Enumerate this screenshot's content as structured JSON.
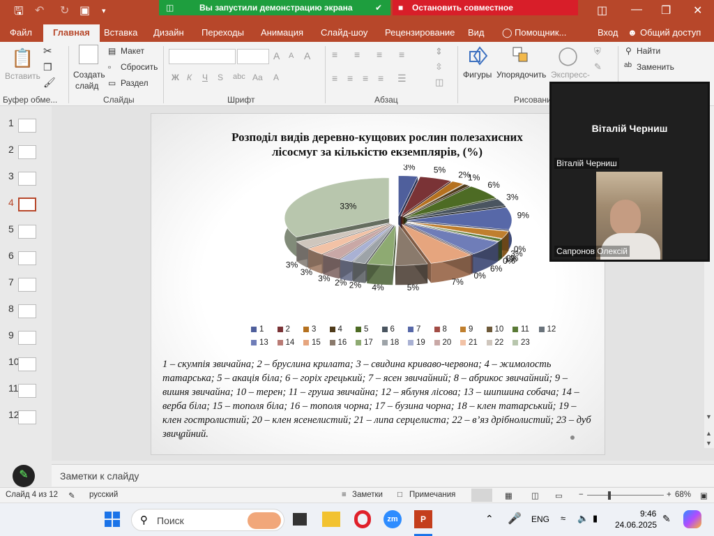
{
  "share": {
    "running": "Вы запустили демонстрацию экрана",
    "stop": "Остановить совместное использование"
  },
  "menu": {
    "file": "Файл",
    "home": "Главная",
    "insert": "Вставка",
    "design": "Дизайн",
    "transitions": "Переходы",
    "animation": "Анимация",
    "slideshow": "Слайд-шоу",
    "review": "Рецензирование",
    "view": "Вид",
    "helper": "Помощник...",
    "signin": "Вход",
    "share_access": "Общий доступ"
  },
  "ribbon": {
    "paste": "Вставить",
    "clipboard": "Буфер обме...",
    "new_slide_1": "Создать",
    "new_slide_2": "слайд",
    "layout": "Макет",
    "reset": "Сбросить",
    "section": "Раздел",
    "slides": "Слайды",
    "font": "Шрифт",
    "paragraph": "Абзац",
    "shapes": "Фигуры",
    "arrange": "Упорядочить",
    "express": "Экспресс-",
    "drawing": "Рисовани",
    "find": "Найти",
    "replace": "Заменить",
    "bold": "Ж",
    "italic": "К",
    "underline": "Ч",
    "strike": "S",
    "font_grow": "A",
    "font_shrink": "A",
    "clear_fmt": "A",
    "spacing": "abc",
    "case": "Aa",
    "color": "A"
  },
  "thumbnails": [
    "1",
    "2",
    "3",
    "4",
    "5",
    "6",
    "7",
    "8",
    "9",
    "10",
    "11",
    "12"
  ],
  "selected_slide": "4",
  "slide": {
    "title_line1": "Розподіл видів деревно-кущових рослин полезахисних",
    "title_line2": "лісосмуг за кількістю екземплярів, (%)",
    "caption": "1 – скумпія звичайна; 2 – бруслина крилата; 3 – свидина криваво-червона; 4 – жимолость татарська; 5 – акація біла; 6 – горіх грецький; 7 – ясен звичайний; 8 – абрикос звичайний; 9 – вишня звичайна; 10 – терен; 11 – груша звичайна; 12 – яблуня лісова; 13 – шипшина собача; 14 – верба біла; 15 – тополя біла; 16 – тополя чорна; 17 – бузина чорна; 18 – клен татарський; 19 – клен гостролистий; 20 – клен ясенелистий; 21 – липа серцелиста; 22 – в’яз дрібнолистий; 23 – дуб звичайний."
  },
  "chart_data": {
    "type": "pie",
    "title": "Розподіл видів деревно-кущових рослин полезахисних лісосмуг за кількістю екземплярів, (%)",
    "categories": [
      "1",
      "2",
      "3",
      "4",
      "5",
      "6",
      "7",
      "8",
      "9",
      "10",
      "11",
      "12",
      "13",
      "14",
      "15",
      "16",
      "17",
      "18",
      "19",
      "20",
      "21",
      "22",
      "23"
    ],
    "values": [
      3,
      5,
      2,
      1,
      6,
      3,
      9,
      0,
      3,
      0,
      1,
      0,
      6,
      0,
      7,
      5,
      4,
      2,
      2,
      3,
      3,
      3,
      33
    ],
    "data_labels": [
      "3%",
      "5%",
      "2%",
      "1%",
      "6%",
      "3%",
      "9%",
      "0%",
      "3%",
      "0%",
      "1%",
      "0%",
      "6%",
      "0%",
      "7%",
      "5%",
      "4%",
      "2%",
      "2%",
      "3%",
      "3%",
      "3%",
      "33%"
    ],
    "colors": [
      "#4f5f9c",
      "#7a3336",
      "#b5711f",
      "#4f3b1a",
      "#4d6b24",
      "#4a5560",
      "#5768a8",
      "#a24c45",
      "#c07f2e",
      "#6e5a3a",
      "#5a7a36",
      "#6a737b",
      "#6f7db8",
      "#b97b75",
      "#e6a57e",
      "#8a7a6c",
      "#8eaa72",
      "#9da3a8",
      "#a9b1d3",
      "#c9a8a6",
      "#f2c2a6",
      "#cfc6bd",
      "#b8c6ad"
    ],
    "legend": "bottom",
    "exploded": true
  },
  "notes_placeholder": "Заметки к слайду",
  "status": {
    "slide_of": "Слайд 4 из 12",
    "lang": "русский",
    "notes": "Заметки",
    "comments": "Примечания",
    "zoom": "68%"
  },
  "video": {
    "presenter": "Віталій Черниш",
    "presenter_tag": "Віталій Черниш",
    "participant": "Сапронов Олексій"
  },
  "taskbar": {
    "search": "Поиск",
    "lang": "ENG",
    "time": "9:46",
    "date": "24.06.2025"
  }
}
